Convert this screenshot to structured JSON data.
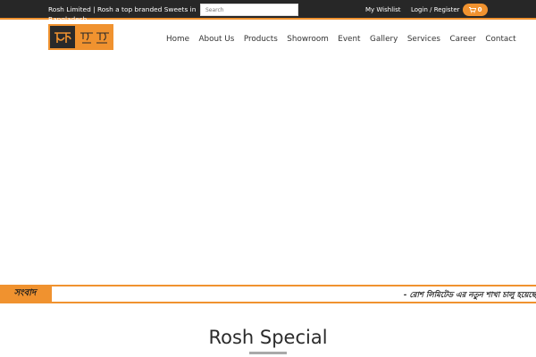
{
  "topbar": {
    "tagline": "Rosh Limited | Rosh a top branded Sweets in Bangladesh",
    "search_placeholder": "Search",
    "wishlist_label": "My Wishlist",
    "login_label": "Login / Register",
    "cart_count": "0"
  },
  "nav": {
    "items": [
      "Home",
      "About Us",
      "Products",
      "Showroom",
      "Event",
      "Gallery",
      "Services",
      "Career",
      "Contact"
    ]
  },
  "ticker": {
    "label": "সংবাদ",
    "text": "- রোশ লিমিটেড এর নতুন শাখা চালু হয়েছে"
  },
  "section": {
    "title": "Rosh Special"
  },
  "colors": {
    "accent": "#f0922f",
    "topbar_bg": "#272727"
  }
}
